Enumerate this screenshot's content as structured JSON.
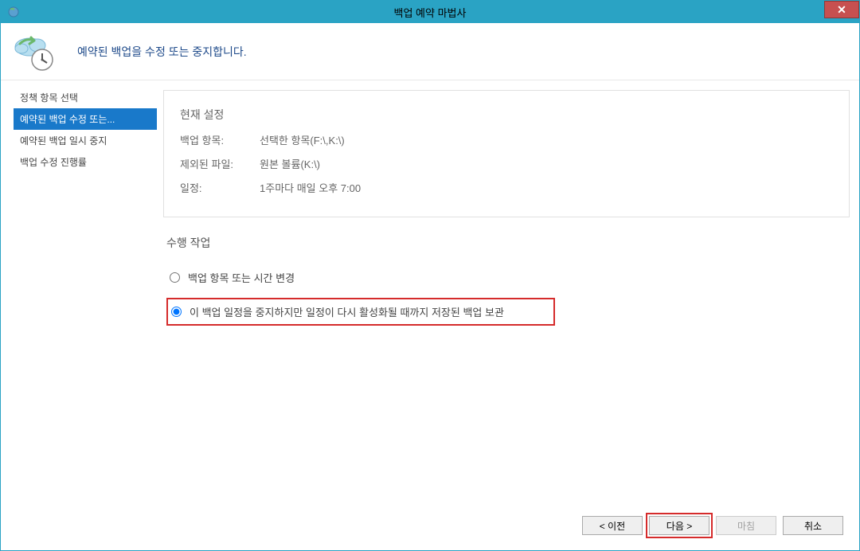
{
  "window": {
    "title": "백업 예약 마법사"
  },
  "header": {
    "title": "예약된 백업을 수정 또는 중지합니다."
  },
  "sidebar": {
    "items": [
      {
        "label": "정책 항목 선택"
      },
      {
        "label": "예약된 백업 수정 또는..."
      },
      {
        "label": "예약된 백업 일시 중지"
      },
      {
        "label": "백업 수정 진행률"
      }
    ]
  },
  "settings": {
    "title": "현재 설정",
    "rows": [
      {
        "label": "백업 항목:",
        "value": "선택한 항목(F:\\,K:\\)"
      },
      {
        "label": "제외된 파일:",
        "value": "원본 볼륨(K:\\)"
      },
      {
        "label": "일정:",
        "value": "1주마다 매일 오후 7:00"
      }
    ]
  },
  "actions": {
    "title": "수행 작업",
    "options": [
      {
        "label": "백업 항목 또는 시간 변경",
        "selected": false
      },
      {
        "label": "이 백업 일정을 중지하지만 일정이 다시 활성화될 때까지 저장된 백업 보관",
        "selected": true
      }
    ]
  },
  "footer": {
    "back": "< 이전",
    "next": "다음 >",
    "finish": "마침",
    "cancel": "취소"
  }
}
